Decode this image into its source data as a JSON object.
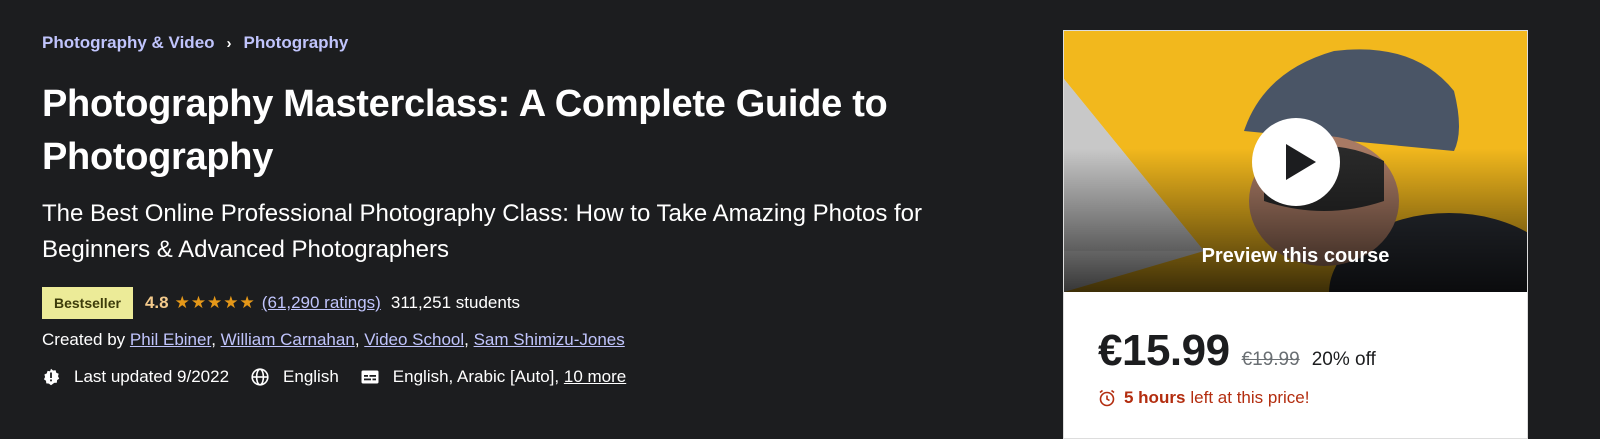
{
  "breadcrumb": {
    "category": "Photography & Video",
    "subcategory": "Photography"
  },
  "course": {
    "title": "Photography Masterclass: A Complete Guide to Photography",
    "subtitle": "The Best Online Professional Photography Class: How to Take Amazing Photos for Beginners & Advanced Photographers",
    "badge": "Bestseller",
    "rating": "4.8",
    "rating_value": 4.8,
    "stars": "★★★★★",
    "ratings_count": "(61,290 ratings)",
    "students": "311,251 students",
    "created_by_label": "Created by",
    "instructors": [
      "Phil Ebiner",
      "William Carnahan",
      "Video School",
      "Sam Shimizu-Jones"
    ],
    "last_updated": "Last updated 9/2022",
    "language": "English",
    "captions": "English, Arabic [Auto],",
    "captions_more": "10 more"
  },
  "card": {
    "preview_label": "Preview this course",
    "price": "€15.99",
    "original_price": "€19.99",
    "discount": "20% off",
    "timer_bold": "5 hours",
    "timer_rest": "left at this price!"
  },
  "colors": {
    "bg": "#1c1d1f",
    "link": "#c0c4fc",
    "badge": "#eceb98",
    "star": "#e59819",
    "alert": "#b32d0f"
  },
  "icons": [
    "chevron-right-icon",
    "star-icon",
    "alert-badge-icon",
    "globe-icon",
    "closed-captions-icon",
    "play-icon",
    "alarm-clock-icon"
  ]
}
